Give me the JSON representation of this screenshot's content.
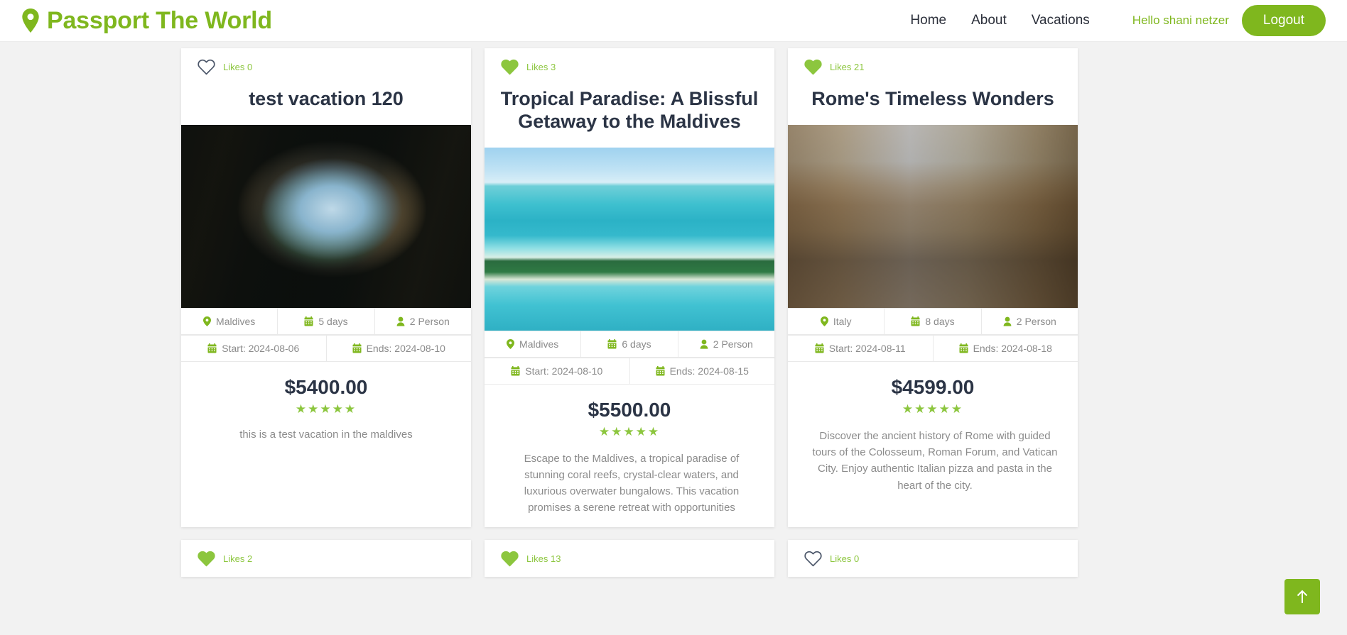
{
  "header": {
    "brand": "Passport The World",
    "brand_icon": "map-pin-icon",
    "brand_color": "#7FB71E",
    "nav": [
      {
        "label": "Home"
      },
      {
        "label": "About"
      },
      {
        "label": "Vacations"
      }
    ],
    "greeting": "Hello shani netzer",
    "logout_label": "Logout"
  },
  "labels": {
    "likes_prefix": "Likes",
    "start_prefix": "Start:",
    "ends_prefix": "Ends:",
    "stars": "★★★★★"
  },
  "scroll_top_button": {
    "name": "scroll-to-top",
    "icon": "arrow-up-icon",
    "color": "#7FB71E"
  },
  "cards": [
    {
      "likes_label": "Likes 0",
      "liked": false,
      "title": "test vacation 120",
      "image": "cave-lake-photo",
      "destination": "Maldives",
      "duration": "5 days",
      "persons": "2 Person",
      "start": "Start: 2024-08-06",
      "ends": "Ends: 2024-08-10",
      "price": "$5400.00",
      "rating": "★★★★★",
      "description": "this is a test vacation in the maldives",
      "scrolling": false
    },
    {
      "likes_label": "Likes 3",
      "liked": true,
      "title": "Tropical Paradise: A Blissful Getaway to the Maldives",
      "image": "maldives-beach-photo",
      "destination": "Maldives",
      "duration": "6 days",
      "persons": "2 Person",
      "start": "Start: 2024-08-10",
      "ends": "Ends: 2024-08-15",
      "price": "$5500.00",
      "rating": "★★★★★",
      "description": "Escape to the Maldives, a tropical paradise of stunning coral reefs, crystal-clear waters, and luxurious overwater bungalows. This vacation promises a serene retreat with opportunities",
      "scrolling": true
    },
    {
      "likes_label": "Likes 21",
      "liked": true,
      "title": "Rome's Timeless Wonders",
      "image": "rome-street-photo",
      "destination": "Italy",
      "duration": "8 days",
      "persons": "2 Person",
      "start": "Start: 2024-08-11",
      "ends": "Ends: 2024-08-18",
      "price": "$4599.00",
      "rating": "★★★★★",
      "description": "Discover the ancient history of Rome with guided tours of the Colosseum, Roman Forum, and Vatican City. Enjoy authentic Italian pizza and pasta in the heart of the city.",
      "scrolling": true
    },
    {
      "likes_label": "Likes 2",
      "liked": true,
      "title": "",
      "image": "",
      "destination": "",
      "duration": "",
      "persons": "",
      "start": "",
      "ends": "",
      "price": "",
      "rating": "",
      "description": "",
      "scrolling": false
    },
    {
      "likes_label": "Likes 13",
      "liked": true,
      "title": "",
      "image": "",
      "destination": "",
      "duration": "",
      "persons": "",
      "start": "",
      "ends": "",
      "price": "",
      "rating": "",
      "description": "",
      "scrolling": false
    },
    {
      "likes_label": "Likes 0",
      "liked": false,
      "title": "",
      "image": "",
      "destination": "",
      "duration": "",
      "persons": "",
      "start": "",
      "ends": "",
      "price": "",
      "rating": "",
      "description": "",
      "scrolling": false
    }
  ]
}
